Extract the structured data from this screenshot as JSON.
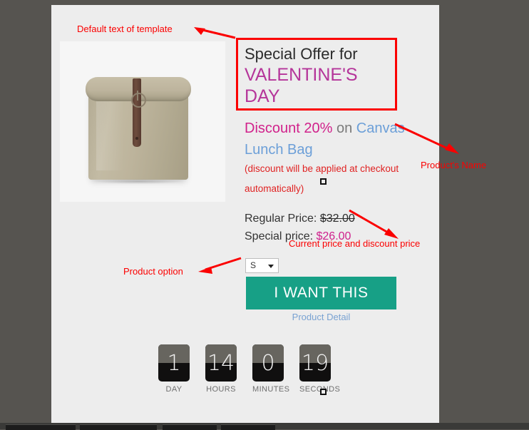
{
  "colors": {
    "desktop": "#565450",
    "panel_bg": "#ededed",
    "annotation_red": "#fb0000",
    "heading_magenta": "#b5359a",
    "discount_pink": "#d1218b",
    "link_blue": "#6c9fd8",
    "cta_teal": "#17a086",
    "note_red": "#e02222"
  },
  "template": {
    "headline_line1": "Special Offer for",
    "headline_line2": "VALENTINE'S DAY",
    "discount_label": "Discount 20%",
    "discount_connector": " on ",
    "product_name": "Canvas Lunch Bag",
    "discount_note": "(discount will be applied at checkout automatically)",
    "regular_price_label": "Regular Price: ",
    "regular_price_value": "$32.00",
    "special_price_label": "Special price: ",
    "special_price_value": "$26.00",
    "option_selected": "S",
    "option_icon": "chevron-down-icon",
    "cta_label": "I WANT THIS",
    "detail_link": "Product Detail"
  },
  "countdown": [
    {
      "value": "1",
      "label": "DAY"
    },
    {
      "value": "14",
      "label": "HOURS"
    },
    {
      "value": "0",
      "label": "MINUTES"
    },
    {
      "value": "19",
      "label": "SECONDS"
    }
  ],
  "annotations": [
    {
      "text": "Default text of template"
    },
    {
      "text": "Product's Name"
    },
    {
      "text": "Current price and discount price"
    },
    {
      "text": "Product option"
    }
  ],
  "product_image": {
    "alt": "canvas-lunch-bag-photo"
  }
}
